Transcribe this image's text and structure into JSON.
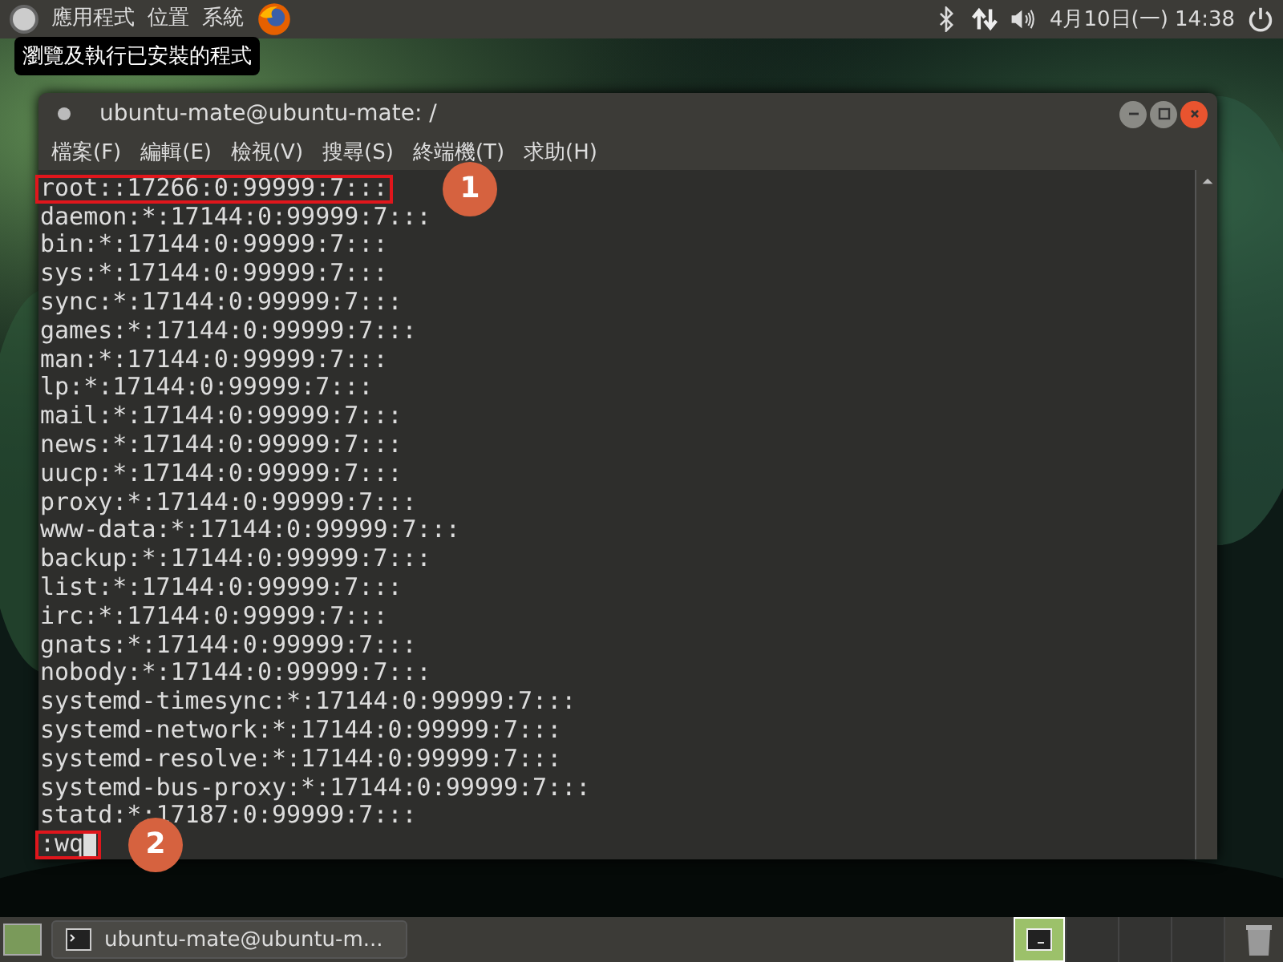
{
  "top_panel": {
    "menus": [
      "應用程式",
      "位置",
      "系統"
    ],
    "clock": "4月10日(一) 14:38"
  },
  "tooltip": {
    "text": "瀏覽及執行已安裝的程式"
  },
  "window": {
    "title": "ubuntu-mate@ubuntu-mate: /",
    "menu": [
      "檔案(F)",
      "編輯(E)",
      "檢視(V)",
      "搜尋(S)",
      "終端機(T)",
      "求助(H)"
    ],
    "lines": [
      {
        "text": "root::17266:0:99999:7:::",
        "highlighted": true,
        "callout": "1"
      },
      {
        "text": "daemon:*:17144:0:99999:7:::",
        "highlighted": false
      },
      {
        "text": "bin:*:17144:0:99999:7:::",
        "highlighted": false
      },
      {
        "text": "sys:*:17144:0:99999:7:::",
        "highlighted": false
      },
      {
        "text": "sync:*:17144:0:99999:7:::",
        "highlighted": false
      },
      {
        "text": "games:*:17144:0:99999:7:::",
        "highlighted": false
      },
      {
        "text": "man:*:17144:0:99999:7:::",
        "highlighted": false
      },
      {
        "text": "lp:*:17144:0:99999:7:::",
        "highlighted": false
      },
      {
        "text": "mail:*:17144:0:99999:7:::",
        "highlighted": false
      },
      {
        "text": "news:*:17144:0:99999:7:::",
        "highlighted": false
      },
      {
        "text": "uucp:*:17144:0:99999:7:::",
        "highlighted": false
      },
      {
        "text": "proxy:*:17144:0:99999:7:::",
        "highlighted": false
      },
      {
        "text": "www-data:*:17144:0:99999:7:::",
        "highlighted": false
      },
      {
        "text": "backup:*:17144:0:99999:7:::",
        "highlighted": false
      },
      {
        "text": "list:*:17144:0:99999:7:::",
        "highlighted": false
      },
      {
        "text": "irc:*:17144:0:99999:7:::",
        "highlighted": false
      },
      {
        "text": "gnats:*:17144:0:99999:7:::",
        "highlighted": false
      },
      {
        "text": "nobody:*:17144:0:99999:7:::",
        "highlighted": false
      },
      {
        "text": "systemd-timesync:*:17144:0:99999:7:::",
        "highlighted": false
      },
      {
        "text": "systemd-network:*:17144:0:99999:7:::",
        "highlighted": false
      },
      {
        "text": "systemd-resolve:*:17144:0:99999:7:::",
        "highlighted": false
      },
      {
        "text": "systemd-bus-proxy:*:17144:0:99999:7:::",
        "highlighted": false
      },
      {
        "text": "statd:*:17187:0:99999:7:::",
        "highlighted": false
      },
      {
        "text": ":wq",
        "highlighted": true,
        "callout": "2",
        "cursor": true
      }
    ]
  },
  "taskbar": {
    "tasks": [
      {
        "label": "ubuntu-mate@ubuntu-m...",
        "selected": false
      }
    ],
    "workspaces": [
      {
        "selected": true
      },
      {
        "selected": false
      },
      {
        "selected": false
      },
      {
        "selected": false
      }
    ]
  }
}
